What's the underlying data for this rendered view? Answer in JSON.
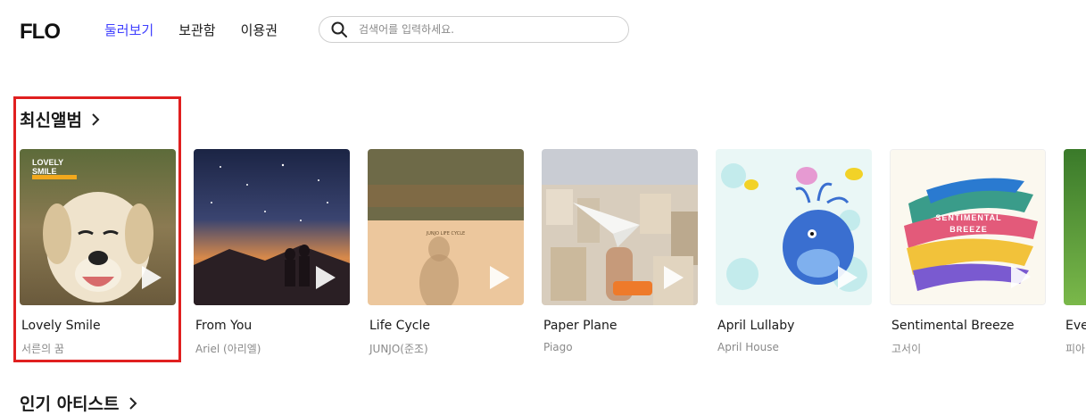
{
  "header": {
    "logo_text": "FLO",
    "nav": [
      {
        "label": "둘러보기",
        "active": true
      },
      {
        "label": "보관함",
        "active": false
      },
      {
        "label": "이용권",
        "active": false
      }
    ],
    "search": {
      "placeholder": "검색어를 입력하세요.",
      "value": ""
    }
  },
  "new_albums": {
    "title": "최신앨범",
    "albums": [
      {
        "title": "Lovely Smile",
        "artist": "서른의 꿈",
        "cover_text": "LOVELY SMILE"
      },
      {
        "title": "From You",
        "artist": "Ariel (아리엘)"
      },
      {
        "title": "Life Cycle",
        "artist": "JUNJO(준조)",
        "cover_text": "JUNJO LIFE CYCLE"
      },
      {
        "title": "Paper Plane",
        "artist": "Piago"
      },
      {
        "title": "April Lullaby",
        "artist": "April House"
      },
      {
        "title": "Sentimental Breeze",
        "artist": "고서이",
        "cover_text": "SENTIMENTAL BREEZE"
      },
      {
        "title": "Eve",
        "artist": "피아"
      }
    ]
  },
  "popular_artists": {
    "title": "인기 아티스트"
  },
  "colors": {
    "accent": "#3f3fff",
    "highlight": "#e02020"
  }
}
